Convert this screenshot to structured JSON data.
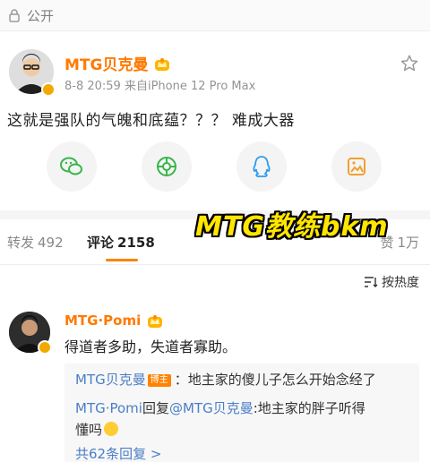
{
  "topbar": {
    "visibility": "公开"
  },
  "post": {
    "author": "MTG贝克曼",
    "meta": "8-8 20:59  来自iPhone 12 Pro Max",
    "text": "这就是强队的气魄和底蕴？？？ 难成大器"
  },
  "share": [
    "wechat-icon",
    "moments-icon",
    "qq-icon",
    "image-share-icon"
  ],
  "tabs": {
    "repost_label": "转发",
    "repost_count": "492",
    "comment_label": "评论",
    "comment_count": "2158",
    "like_label": "赞",
    "like_count": "1万"
  },
  "watermark": "MTG教练bkm",
  "sort": {
    "label": "按热度"
  },
  "comment": {
    "author": "MTG·Pomi",
    "text": "得道者多助，失道者寡助。",
    "replies": [
      {
        "name": "MTG贝克曼",
        "tag": "博主",
        "text": "：地主家的傻儿子怎么开始念经了"
      },
      {
        "name": "MTG·Pomi",
        "verb": "回复",
        "mention": "@MTG贝克曼",
        "text": ":地主家的胖子听得",
        "text2": "懂吗"
      }
    ],
    "more": "共62条回复 >"
  },
  "colors": {
    "accent": "#ff8200",
    "link": "#4a7ec6",
    "author": "#ff7a00"
  }
}
